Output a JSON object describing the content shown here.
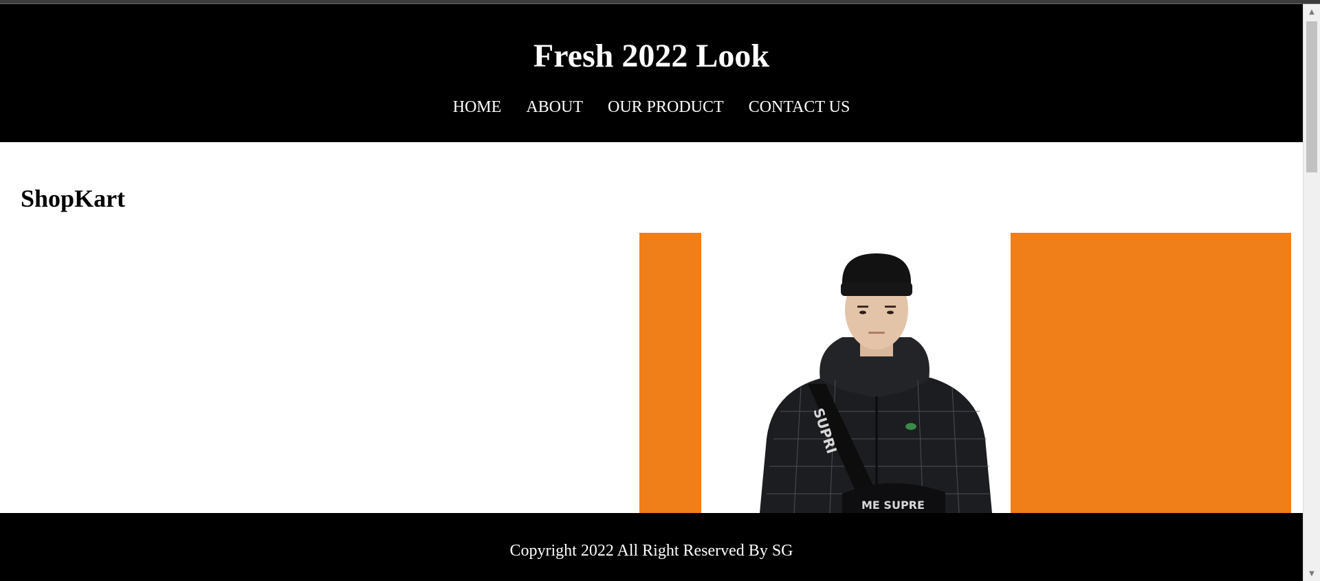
{
  "header": {
    "title": "Fresh 2022 Look",
    "nav": [
      {
        "label": "HOME"
      },
      {
        "label": "ABOUT"
      },
      {
        "label": "OUR PRODUCT"
      },
      {
        "label": "CONTACT US"
      }
    ]
  },
  "main": {
    "brand": "ShopKart",
    "hero": {
      "image_icon": "model-photo",
      "accent_color": "#f07e19"
    }
  },
  "footer": {
    "copyright": "Copyright 2022 All Right Reserved By SG"
  },
  "colors": {
    "header_bg": "#000000",
    "footer_bg": "#000000",
    "accent": "#f07e19",
    "text_light": "#ffffff"
  }
}
